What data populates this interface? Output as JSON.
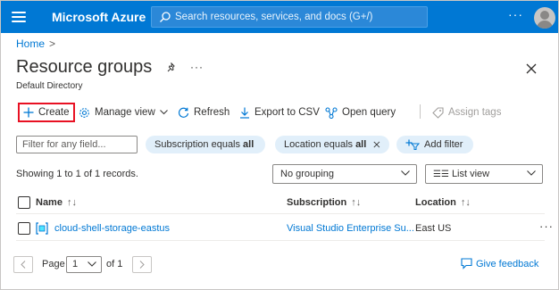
{
  "topbar": {
    "brand": "Microsoft Azure",
    "search_placeholder": "Search resources, services, and docs (G+/)",
    "more": "···"
  },
  "breadcrumb": {
    "home": "Home",
    "sep": ">"
  },
  "page": {
    "title": "Resource groups",
    "subtitle": "Default Directory",
    "more": "···"
  },
  "toolbar": {
    "create": "Create",
    "manage_view": "Manage view",
    "refresh": "Refresh",
    "export_csv": "Export to CSV",
    "open_query": "Open query",
    "assign_tags": "Assign tags"
  },
  "filters": {
    "placeholder": "Filter for any field...",
    "subscription_prefix": "Subscription equals",
    "subscription_value": "all",
    "location_prefix": "Location equals",
    "location_value": "all",
    "add_filter": "Add filter"
  },
  "records_text": "Showing 1 to 1 of 1 records.",
  "grouping": "No grouping",
  "view_mode": "List view",
  "table": {
    "columns": [
      "Name",
      "Subscription",
      "Location"
    ],
    "sort_glyph": "↑↓",
    "rows": [
      {
        "name": "cloud-shell-storage-eastus",
        "subscription": "Visual Studio Enterprise Su...",
        "location": "East US",
        "more": "···"
      }
    ]
  },
  "pagination": {
    "page_label": "Page",
    "current": "1",
    "of_label": "of 1"
  },
  "feedback": "Give feedback",
  "colors": {
    "brand_blue": "#0078d4",
    "create_highlight": "#e81123",
    "pill_bg": "#e1effa"
  }
}
